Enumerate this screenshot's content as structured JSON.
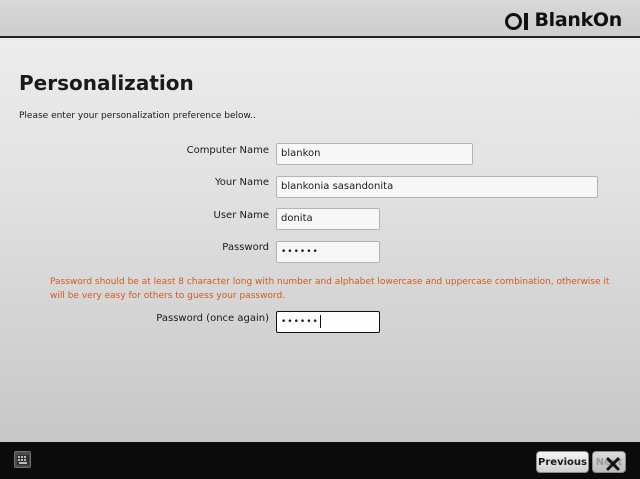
{
  "header": {
    "logo_text": "BlankOn"
  },
  "page": {
    "title": "Personalization",
    "subtitle": "Please enter your personalization preference below.."
  },
  "form": {
    "computer_name": {
      "label": "Computer Name",
      "value": "blankon"
    },
    "your_name": {
      "label": "Your Name",
      "value": "blankonia sasandonita"
    },
    "user_name": {
      "label": "User Name",
      "value": "donita"
    },
    "password": {
      "label": "Password",
      "value": "••••••"
    },
    "password_hint": "Password should be at least 8 character long with number and alphabet lowercase and uppercase combination, otherwise it will be very easy for others to guess your password.",
    "password_again": {
      "label": "Password (once again)",
      "value": "••••••"
    }
  },
  "footer": {
    "previous_label": "Previous",
    "next_label": "Next"
  },
  "colors": {
    "hint_text": "#d05a1e",
    "header_rule": "#222222",
    "bottom_bar": "#0b0b0b"
  },
  "icons": {
    "keyboard": "keyboard-icon",
    "close": "close-icon"
  }
}
